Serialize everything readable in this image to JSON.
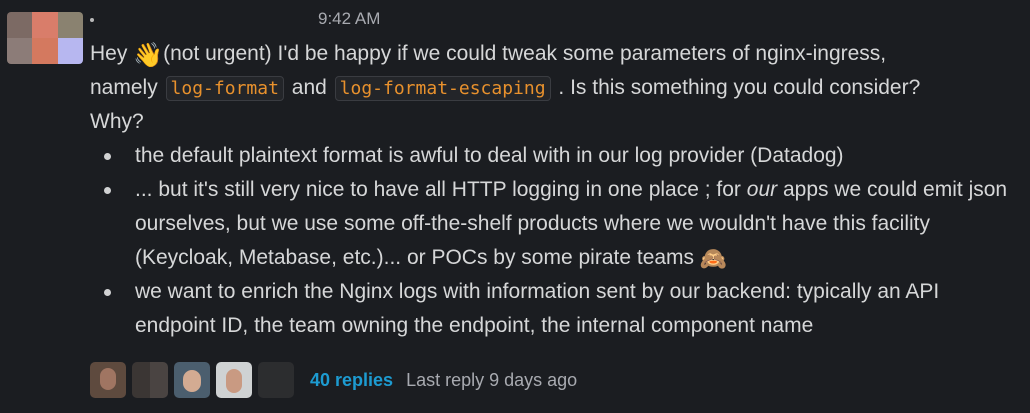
{
  "message": {
    "timestamp": "9:42 AM",
    "line1_a": "Hey",
    "line1_emoji": "👋",
    "line1_b": "(not urgent) I'd be happy if we could tweak some parameters of nginx-ingress,",
    "line2_a": "namely",
    "code1": "log-format",
    "line2_b": "and",
    "code2": "log-format-escaping",
    "line2_c": ". Is this something you could consider?",
    "line3": "Why?",
    "bullets": {
      "b1": "the default plaintext format is awful to deal with in our log provider (Datadog)",
      "b2_a": "... but it's still very nice to have all HTTP logging in one place ; for",
      "b2_em": "our",
      "b2_b": "apps we could emit json ourselves, but we use some off-the-shelf products where we wouldn't have this facility (Keycloak, Metabase, etc.)... or POCs by some pirate teams",
      "b2_emoji": "🙈",
      "b3": "we want to enrich the Nginx logs with information sent by our backend: typically an API endpoint ID, the team owning the endpoint, the internal component name"
    }
  },
  "thread": {
    "replies_label": "40 replies",
    "last_reply_label": "Last reply 9 days ago"
  }
}
